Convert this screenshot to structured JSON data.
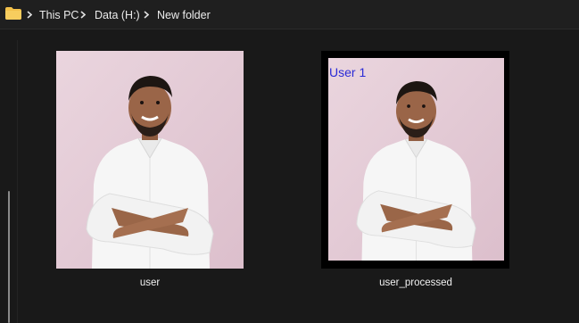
{
  "breadcrumb": {
    "items": [
      {
        "label": "This PC"
      },
      {
        "label": "Data (H:)"
      },
      {
        "label": "New folder"
      }
    ]
  },
  "files": [
    {
      "name": "user"
    },
    {
      "name": "user_processed",
      "overlay_text": "User 1"
    }
  ],
  "colors": {
    "folder": "#f3c14b",
    "overlay_text": "#2a2ad6",
    "thumbnail_background": "#e7cfd9",
    "processed_border": "#000000"
  },
  "icons": {
    "folder": "folder-icon",
    "separator": "chevron-right-icon"
  }
}
